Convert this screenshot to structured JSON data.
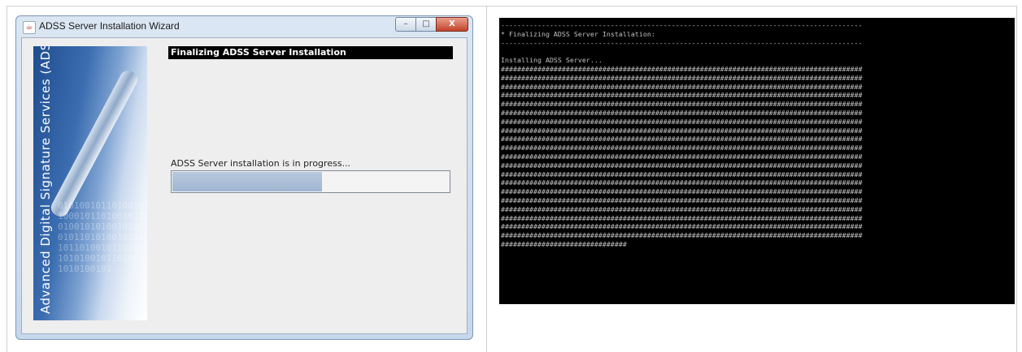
{
  "wizard": {
    "title": "ADSS Server Installation Wizard",
    "controls": {
      "minimize": "–",
      "maximize": "□",
      "close": "X"
    },
    "banner": {
      "text": "Advanced Digital Signature Services (ADSS)",
      "digits": "0101001011010010101000101101001011010100101010010110100101101010010101001011010010110101001010100101101001011010100101"
    },
    "header": "Finalizing ADSS Server Installation",
    "status": "ADSS Server installation is in progress...",
    "progress_fraction": 0.54,
    "icon": "java-cup-icon"
  },
  "console": {
    "lines": [
      "-----------------------------------------------------------------------------------------",
      "* Finalizing ADSS Server Installation:",
      "-----------------------------------------------------------------------------------------",
      "",
      "Installing ADSS Server...",
      "#########################################################################################",
      "#########################################################################################",
      "#########################################################################################",
      "#########################################################################################",
      "#########################################################################################",
      "#########################################################################################",
      "#########################################################################################",
      "#########################################################################################",
      "#########################################################################################",
      "#########################################################################################",
      "#########################################################################################",
      "#########################################################################################",
      "#########################################################################################",
      "#########################################################################################",
      "#########################################################################################",
      "#########################################################################################",
      "#########################################################################################",
      "#########################################################################################",
      "#########################################################################################",
      "#########################################################################################",
      "###############################"
    ]
  }
}
